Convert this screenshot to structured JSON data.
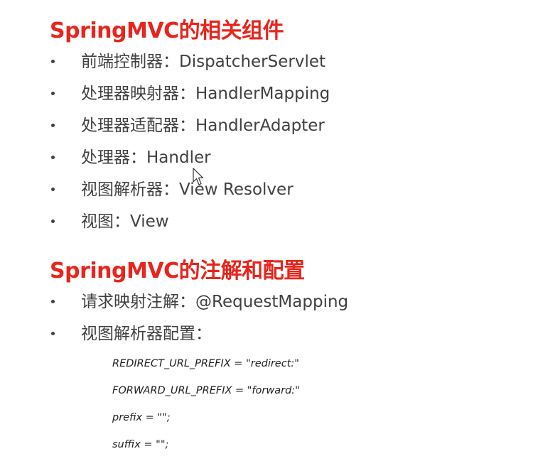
{
  "section1": {
    "title": "SpringMVC的相关组件",
    "items": [
      "前端控制器：DispatcherServlet",
      "处理器映射器：HandlerMapping",
      "处理器适配器：HandlerAdapter",
      "处理器：Handler",
      "视图解析器：View Resolver",
      "视图：View"
    ]
  },
  "section2": {
    "title": "SpringMVC的注解和配置",
    "items": [
      "请求映射注解：@RequestMapping",
      "视图解析器配置："
    ],
    "code_lines": [
      "REDIRECT_URL_PREFIX = \"redirect:\"",
      "FORWARD_URL_PREFIX = \"forward:\"",
      "prefix = \"\";",
      "suffix = \"\";"
    ]
  },
  "colors": {
    "heading": "#e8241c",
    "body_text": "#404040",
    "background": "#ffffff"
  },
  "icons": {
    "cursor": "mouse-pointer-icon"
  }
}
